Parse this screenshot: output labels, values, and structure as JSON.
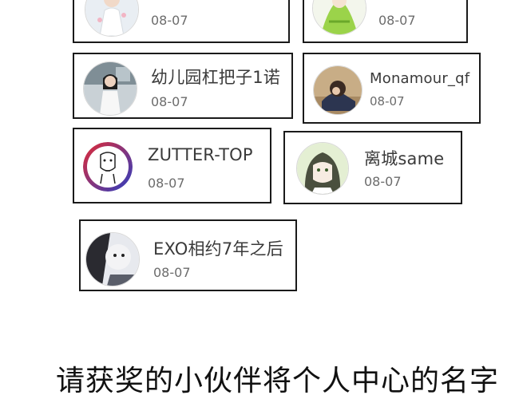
{
  "cards": [
    {
      "name": "",
      "date": "08-07",
      "avatar_icon": "avatar-white-dress-icon"
    },
    {
      "name": "",
      "date": "08-07",
      "avatar_icon": "avatar-green-anime-icon"
    },
    {
      "name": "幼儿园杠把子1诺",
      "date": "08-07",
      "avatar_icon": "avatar-girl-photo-icon"
    },
    {
      "name": "Monamour_qf",
      "date": "08-07",
      "avatar_icon": "avatar-girl-desk-icon"
    },
    {
      "name": "ZUTTER-TOP",
      "date": "08-07",
      "avatar_icon": "avatar-red-blue-portrait-icon"
    },
    {
      "name": "离城same",
      "date": "08-07",
      "avatar_icon": "avatar-anime-girl-icon"
    },
    {
      "name": "EXO相约7年之后",
      "date": "08-07",
      "avatar_icon": "avatar-cat-sleeve-icon"
    }
  ],
  "footer": {
    "text": "请获奖的小伙伴将个人中心的名字"
  }
}
